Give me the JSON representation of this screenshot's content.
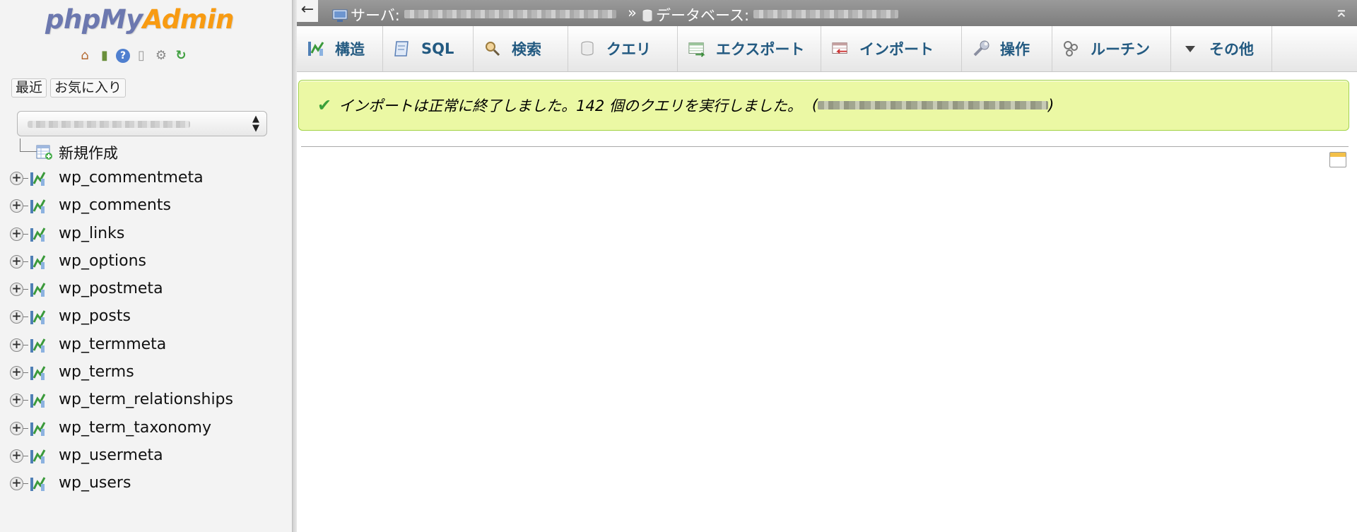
{
  "logo": {
    "php": "php",
    "my": "My",
    "admin": "Admin"
  },
  "nav_icons": [
    "home-icon",
    "exit-icon",
    "help-icon",
    "docs-icon",
    "settings-icon",
    "reload-icon"
  ],
  "sidebar": {
    "recent_label": "最近",
    "favorites_label": "お気に入り",
    "new_item_label": "新規作成",
    "tables": [
      "wp_commentmeta",
      "wp_comments",
      "wp_links",
      "wp_options",
      "wp_postmeta",
      "wp_posts",
      "wp_termmeta",
      "wp_terms",
      "wp_term_relationships",
      "wp_term_taxonomy",
      "wp_usermeta",
      "wp_users"
    ]
  },
  "breadcrumb": {
    "back_icon": "←",
    "server_label": "サーバ:",
    "separator": "»",
    "database_label": "データベース:",
    "collapse_icon": "⌅"
  },
  "tabs": [
    {
      "label": "構造",
      "icon": "structure-icon"
    },
    {
      "label": "SQL",
      "icon": "sql-icon"
    },
    {
      "label": "検索",
      "icon": "search-icon"
    },
    {
      "label": "クエリ",
      "icon": "query-icon"
    },
    {
      "label": "エクスポート",
      "icon": "export-icon"
    },
    {
      "label": "インポート",
      "icon": "import-icon"
    },
    {
      "label": "操作",
      "icon": "operations-icon"
    },
    {
      "label": "ルーチン",
      "icon": "routines-icon"
    },
    {
      "label": "その他",
      "icon": "more-icon"
    }
  ],
  "message": {
    "text": "インポートは正常に終了しました。142 個のクエリを実行しました。",
    "open_paren": "(",
    "close_paren": ")"
  }
}
